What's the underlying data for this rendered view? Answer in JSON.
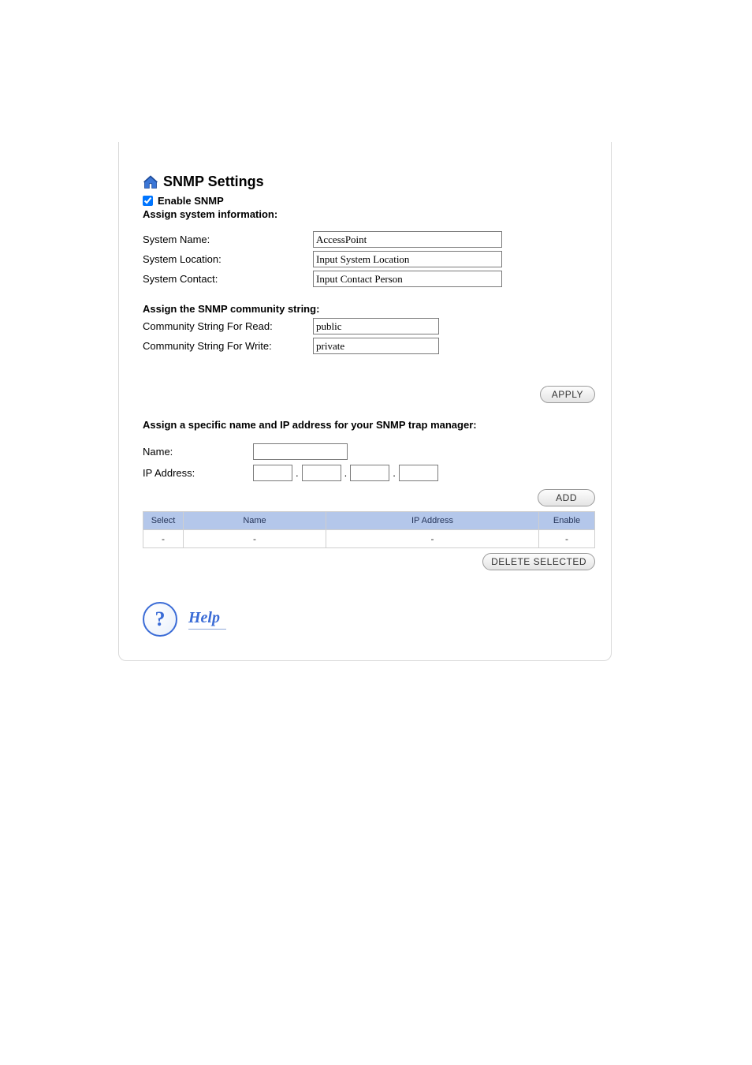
{
  "page": {
    "title": "SNMP Settings",
    "enable_label": "Enable SNMP",
    "enable_checked": true
  },
  "sysinfo": {
    "heading": "Assign system information:",
    "name_label": "System Name:",
    "name_value": "AccessPoint",
    "location_label": "System Location:",
    "location_value": "Input System Location",
    "contact_label": "System Contact:",
    "contact_value": "Input Contact Person"
  },
  "community": {
    "heading": "Assign the SNMP community string:",
    "read_label": "Community String For Read:",
    "read_value": "public",
    "write_label": "Community String For Write:",
    "write_value": "private"
  },
  "buttons": {
    "apply": "APPLY",
    "add": "ADD",
    "delete": "DELETE SELECTED"
  },
  "trap": {
    "heading": "Assign a specific name and IP address for your SNMP trap manager:",
    "name_label": "Name:",
    "ip_label": "IP Address:",
    "table": {
      "headers": {
        "select": "Select",
        "name": "Name",
        "ip": "IP Address",
        "enable": "Enable"
      },
      "rows": [
        {
          "select": "-",
          "name": "-",
          "ip": "-",
          "enable": "-"
        }
      ]
    }
  },
  "help": {
    "label": "Help"
  }
}
